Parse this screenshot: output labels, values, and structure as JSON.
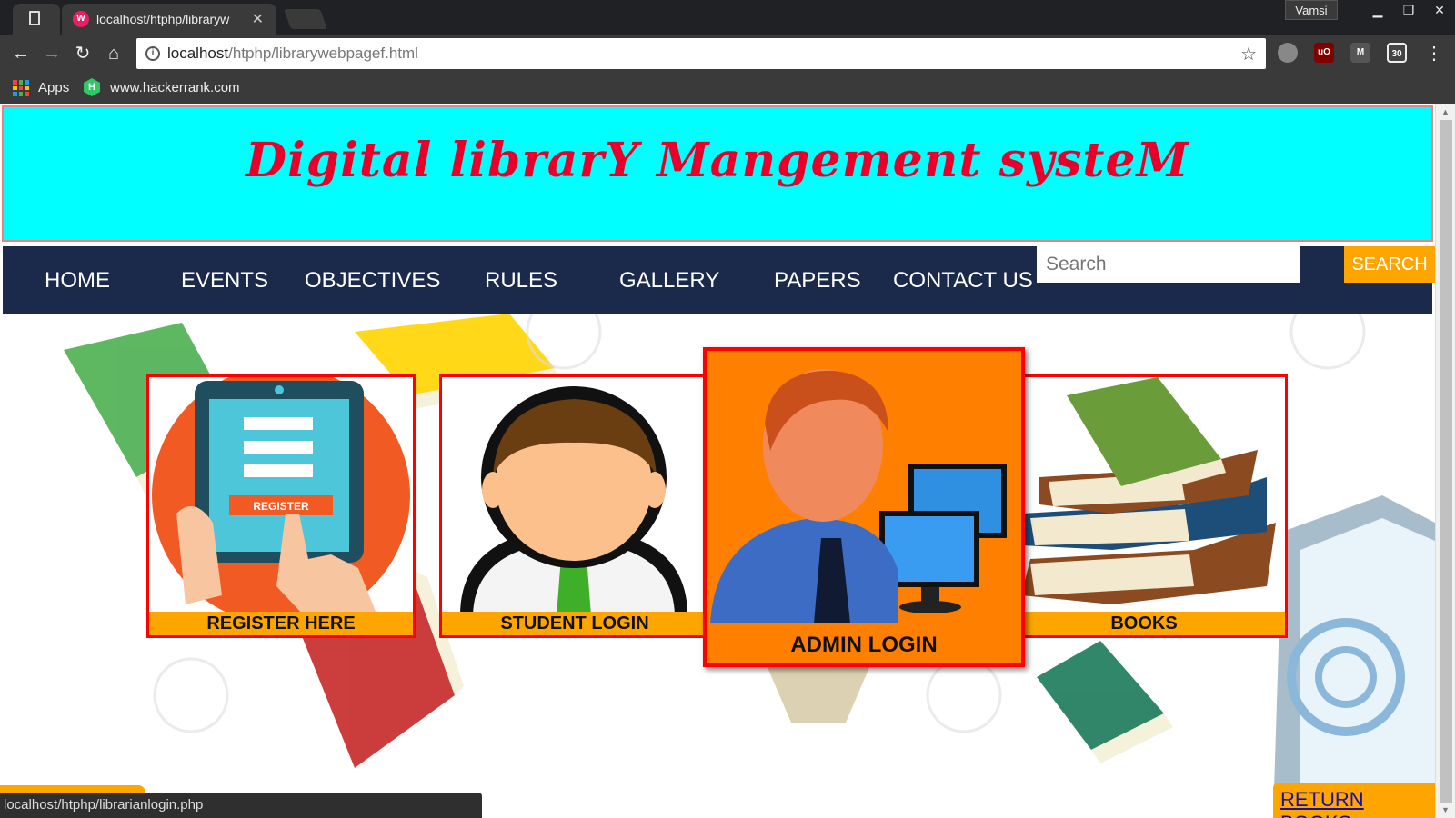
{
  "browser": {
    "tab_title": "localhost/htphp/libraryw",
    "profile_name": "Vamsi",
    "url_host": "localhost",
    "url_path": "/htphp/librarywebpagef.html",
    "bookmarks": [
      "Apps",
      "www.hackerrank.com"
    ],
    "status_url": "localhost/htphp/librarianlogin.php"
  },
  "header": {
    "title": "Digital librarY Mangement systeM"
  },
  "nav": {
    "items": [
      "HOME",
      "EVENTS",
      "OBJECTIVES",
      "RULES",
      "GALLERY",
      "PAPERS",
      "CONTACT US"
    ],
    "search_placeholder": "Search",
    "search_button": "SEARCH"
  },
  "cards": {
    "register": "REGISTER HERE",
    "register_tablet_label": "REGISTER",
    "student": "STUDENT LOGIN",
    "admin": "ADMIN LOGIN",
    "books": "BOOKS"
  },
  "footer": {
    "return_books": "RETURN BOOKS"
  },
  "colors": {
    "banner_bg": "#00ffff",
    "title_color": "#e8002a",
    "nav_bg": "#1b2a4a",
    "accent_orange": "#ffa500",
    "card_border": "#ff0000"
  },
  "icons": [
    "document-icon",
    "close-icon",
    "back-arrow-icon",
    "forward-arrow-icon",
    "reload-icon",
    "home-icon",
    "info-icon",
    "star-icon",
    "menu-dots-icon",
    "apps-grid-icon",
    "hackerrank-icon"
  ]
}
